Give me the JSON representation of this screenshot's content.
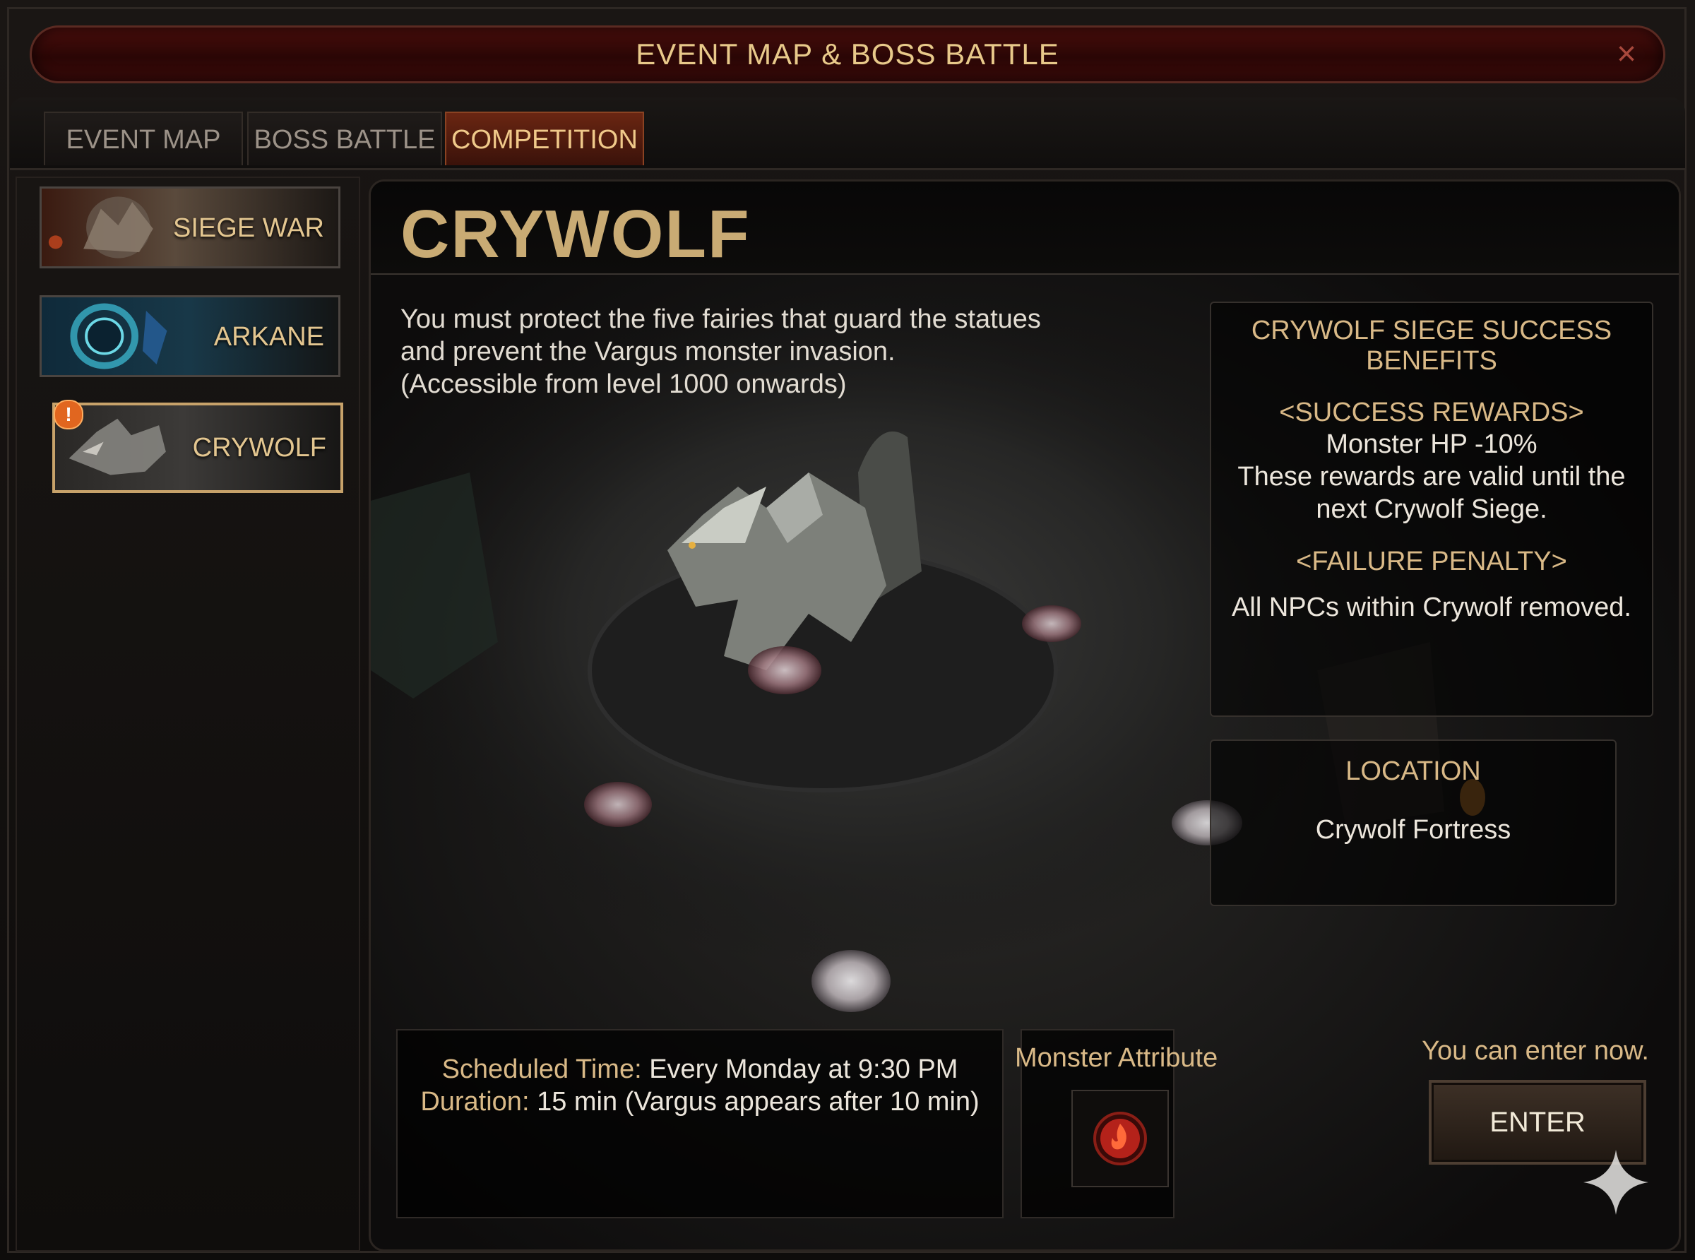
{
  "window": {
    "title": "EVENT MAP & BOSS BATTLE",
    "close_icon": "×"
  },
  "tabs": [
    {
      "label": "EVENT MAP",
      "active": false
    },
    {
      "label": "BOSS BATTLE",
      "active": false
    },
    {
      "label": "COMPETITION",
      "active": true
    }
  ],
  "sidebar": {
    "items": [
      {
        "label": "SIEGE WAR",
        "icon": "dragon-emblem-icon",
        "active": false
      },
      {
        "label": "ARKANE",
        "icon": "portal-icon",
        "active": false
      },
      {
        "label": "CRYWOLF",
        "icon": "wolf-icon",
        "active": true,
        "badge": "!"
      }
    ]
  },
  "main": {
    "title": "CRYWOLF",
    "description": [
      "You must protect the five fairies that guard the statues",
      "and prevent the Vargus monster invasion.",
      "(Accessible from level 1000 onwards)"
    ],
    "benefits": {
      "title": "CRYWOLF SIEGE SUCCESS BENEFITS",
      "success_header": "<SUCCESS REWARDS>",
      "success_lines": [
        "Monster HP -10%",
        "These rewards are valid until the",
        "next Crywolf Siege."
      ],
      "failure_header": "<FAILURE PENALTY>",
      "failure_text": "All NPCs within Crywolf removed."
    },
    "location": {
      "title": "LOCATION",
      "value": "Crywolf Fortress"
    },
    "schedule": {
      "time_label": "Scheduled Time:",
      "time_value": "Every Monday at 9:30 PM",
      "duration_label": "Duration:",
      "duration_value": "15 min (Vargus appears after 10 min)"
    },
    "monster_attribute": {
      "title": "Monster Attribute",
      "icon": "fire-element-icon"
    },
    "enter": {
      "status": "You can enter now.",
      "button_label": "ENTER"
    }
  },
  "colors": {
    "accent_gold": "#d9b987",
    "title_red": "#2a0605",
    "active_tab": "#6a2612",
    "badge_orange": "#e1661f"
  }
}
